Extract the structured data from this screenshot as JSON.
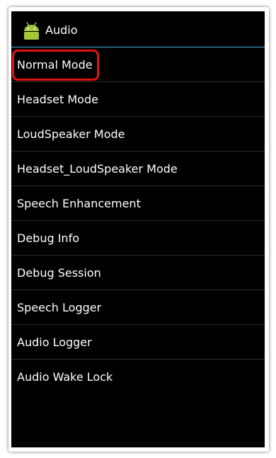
{
  "app": {
    "title": "Audio",
    "icon": "android-robot-icon",
    "accent_color": "#4aaee6",
    "icon_color": "#a4c639"
  },
  "menu": {
    "items": [
      {
        "label": "Normal Mode",
        "highlighted": true
      },
      {
        "label": "Headset Mode"
      },
      {
        "label": "LoudSpeaker Mode"
      },
      {
        "label": "Headset_LoudSpeaker Mode"
      },
      {
        "label": "Speech Enhancement"
      },
      {
        "label": "Debug Info"
      },
      {
        "label": "Debug Session"
      },
      {
        "label": "Speech Logger"
      },
      {
        "label": "Audio Logger"
      },
      {
        "label": "Audio Wake Lock"
      }
    ]
  },
  "annotation": {
    "color": "#e11414"
  }
}
